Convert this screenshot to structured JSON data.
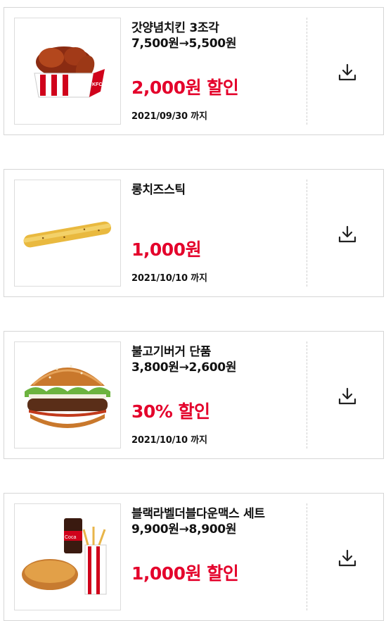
{
  "coupons": [
    {
      "name": "갓양념치킨 3조각",
      "price": "7,500원→5,500원",
      "discount": "2,000원 할인",
      "expiry": "2021/09/30 까지",
      "image_icon": "chicken-bucket-image"
    },
    {
      "name": "롱치즈스틱",
      "price": "",
      "discount": "1,000원",
      "expiry": "2021/10/10 까지",
      "image_icon": "cheese-stick-image"
    },
    {
      "name": "불고기버거 단품",
      "price": "3,800원→2,600원",
      "discount": "30% 할인",
      "expiry": "2021/10/10 까지",
      "image_icon": "bulgogi-burger-image"
    },
    {
      "name": "블랙라벨더블다운맥스 세트",
      "price": "9,900원→8,900원",
      "discount": "1,000원 할인",
      "expiry": "",
      "image_icon": "burger-set-image"
    }
  ],
  "colors": {
    "accent": "#e4002b",
    "border": "#d6d6d6"
  },
  "download_icon": "download-icon"
}
